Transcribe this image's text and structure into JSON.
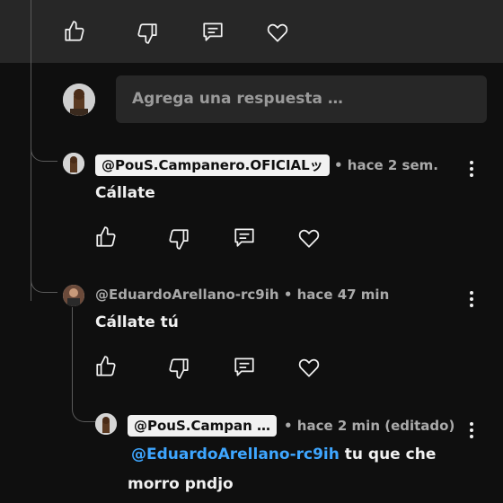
{
  "reply_box": {
    "placeholder": "Agrega una respuesta …"
  },
  "comments": [
    {
      "author": "@PouS.Campanero.OFICIALッ",
      "time": "• hace 2 sem.",
      "text": "Cállate"
    },
    {
      "author": "@EduardoArellano-rc9ih",
      "time": "• hace 47 min",
      "text": "Cállate tú"
    },
    {
      "author": "@PouS.Campan …",
      "time": "• hace 2 min (editado)",
      "mention": "@EduardoArellano-rc9ih",
      "text_rest": "tu que che",
      "text_line2": "morro pndjo"
    }
  ],
  "icons": [
    "like-icon",
    "dislike-icon",
    "reply-icon",
    "heart-icon",
    "more-vert-icon"
  ],
  "colors": {
    "background": "#0f0f0f",
    "panel": "#272727",
    "mention": "#3ea6ff",
    "chip": "#f1f1f1"
  }
}
